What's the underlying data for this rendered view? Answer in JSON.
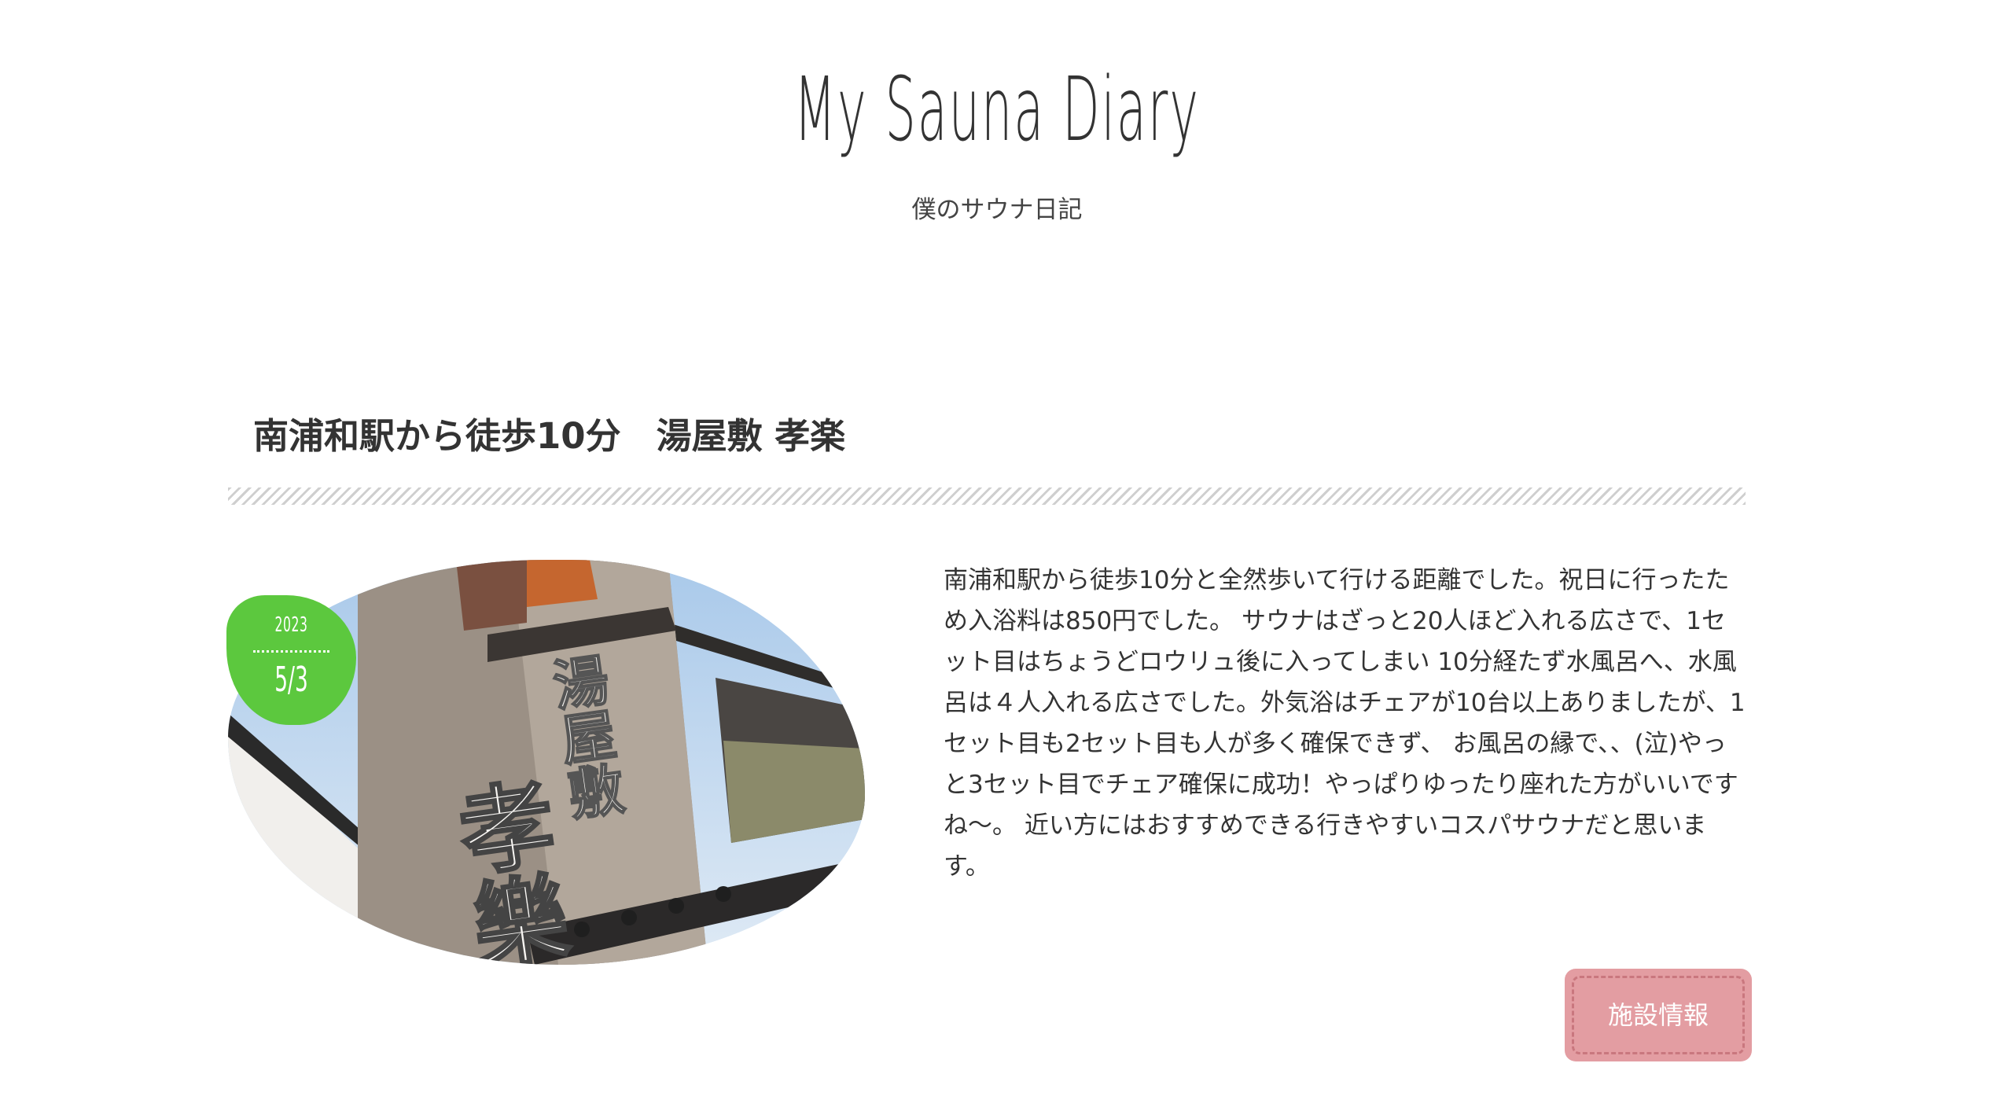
{
  "site": {
    "title": "My Sauna Diary",
    "subtitle": "僕のサウナ日記"
  },
  "post": {
    "title": "南浦和駅から徒歩10分　湯屋敷 孝楽",
    "date": {
      "year": "2023",
      "month_day": "5/3"
    },
    "image": {
      "sign_text": "湯屋敷",
      "logo_text": "孝樂"
    },
    "body": "南浦和駅から徒歩10分と全然歩いて行ける距離でした。祝日に行ったため入浴料は850円でした。 サウナはざっと20人ほど入れる広さで、1セット目はちょうどロウリュ後に入ってしまい 10分経たず水風呂へ、水風呂は４人入れる広さでした。外気浴はチェアが10台以上ありましたが、1セット目も2セット目も人が多く確保できず、 お風呂の縁で、、(泣)やっと3セット目でチェア確保に成功！やっぱりゆったり座れた方がいいですね〜。 近い方にはおすすめできる行きやすいコスパサウナだと思います。",
    "facility_button_label": "施設情報"
  },
  "colors": {
    "badge": "#5cc83e",
    "button": "#e39da2",
    "button_border": "#c9777e"
  }
}
